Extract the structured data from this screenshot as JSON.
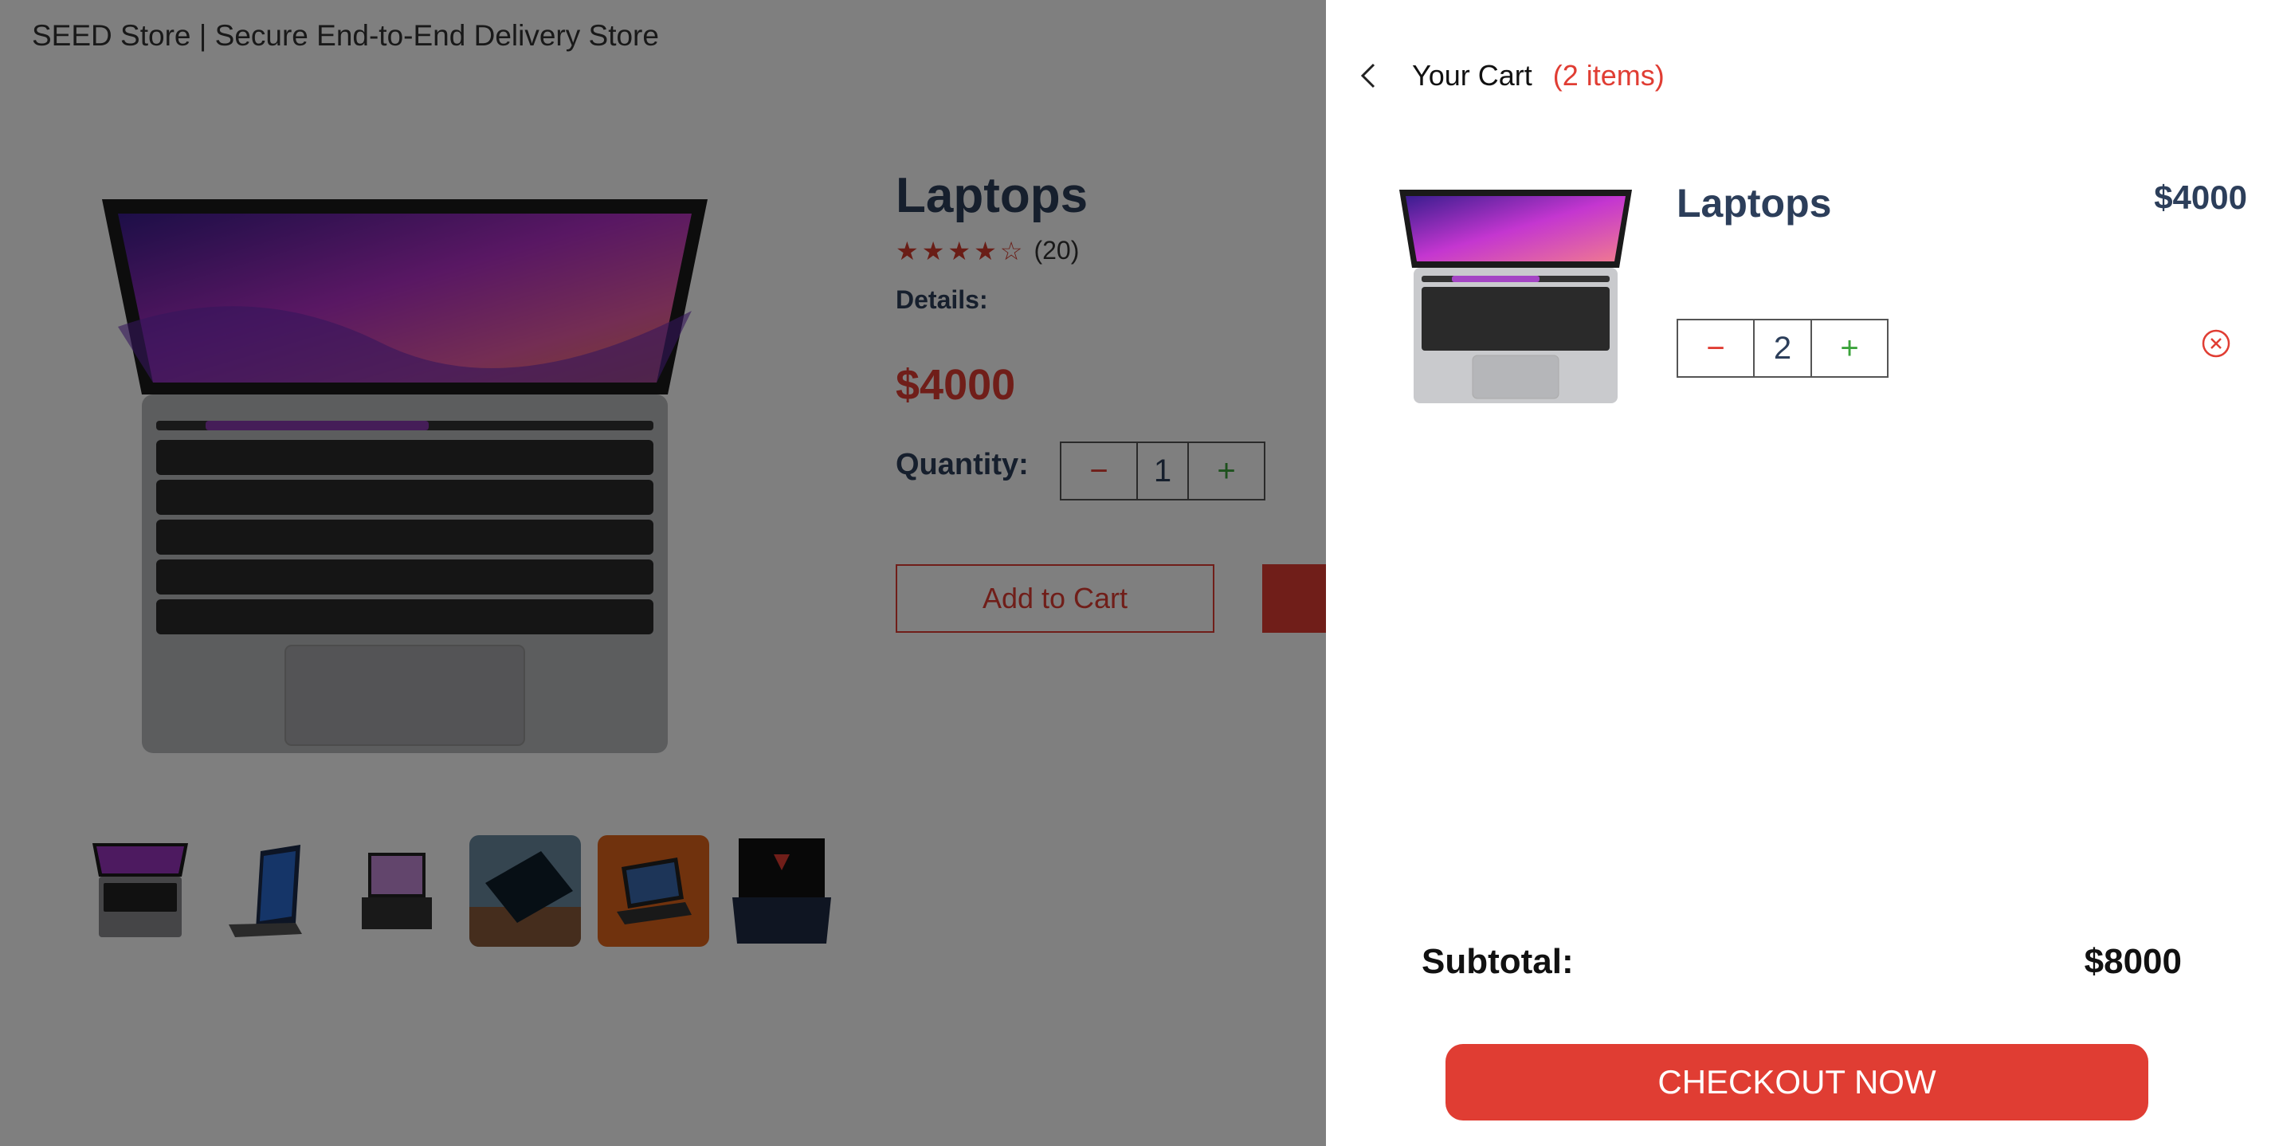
{
  "store": {
    "title": "SEED Store | Secure End-to-End Delivery Store"
  },
  "product": {
    "title": "Laptops",
    "rating_stars": 4,
    "rating_max": 5,
    "rating_count": "(20)",
    "details_label": "Details:",
    "price": "$4000",
    "quantity_label": "Quantity:",
    "quantity_minus": "−",
    "quantity_value": "1",
    "quantity_plus": "+",
    "add_to_cart_label": "Add to Cart",
    "thumbnails": [
      "macbook-thumbnail",
      "laptop-thumbnail-2",
      "laptop-thumbnail-3",
      "laptop-thumbnail-4",
      "laptop-thumbnail-5",
      "laptop-thumbnail-6"
    ]
  },
  "cart": {
    "heading": "Your Cart",
    "count_label": "(2 items)",
    "items": [
      {
        "name": "Laptops",
        "price": "$4000",
        "quantity": "2",
        "minus": "−",
        "plus": "+"
      }
    ],
    "subtotal_label": "Subtotal:",
    "subtotal_value": "$8000",
    "checkout_label": "CHECKOUT NOW"
  },
  "colors": {
    "accent": "#e03d33",
    "heading": "#2c3e5a",
    "plus": "#3ba33b",
    "overlay": "rgba(0,0,0,0.5)"
  },
  "icons": {
    "back": "chevron-left-icon",
    "remove": "remove-circle-x-icon",
    "star": "star-icon"
  }
}
